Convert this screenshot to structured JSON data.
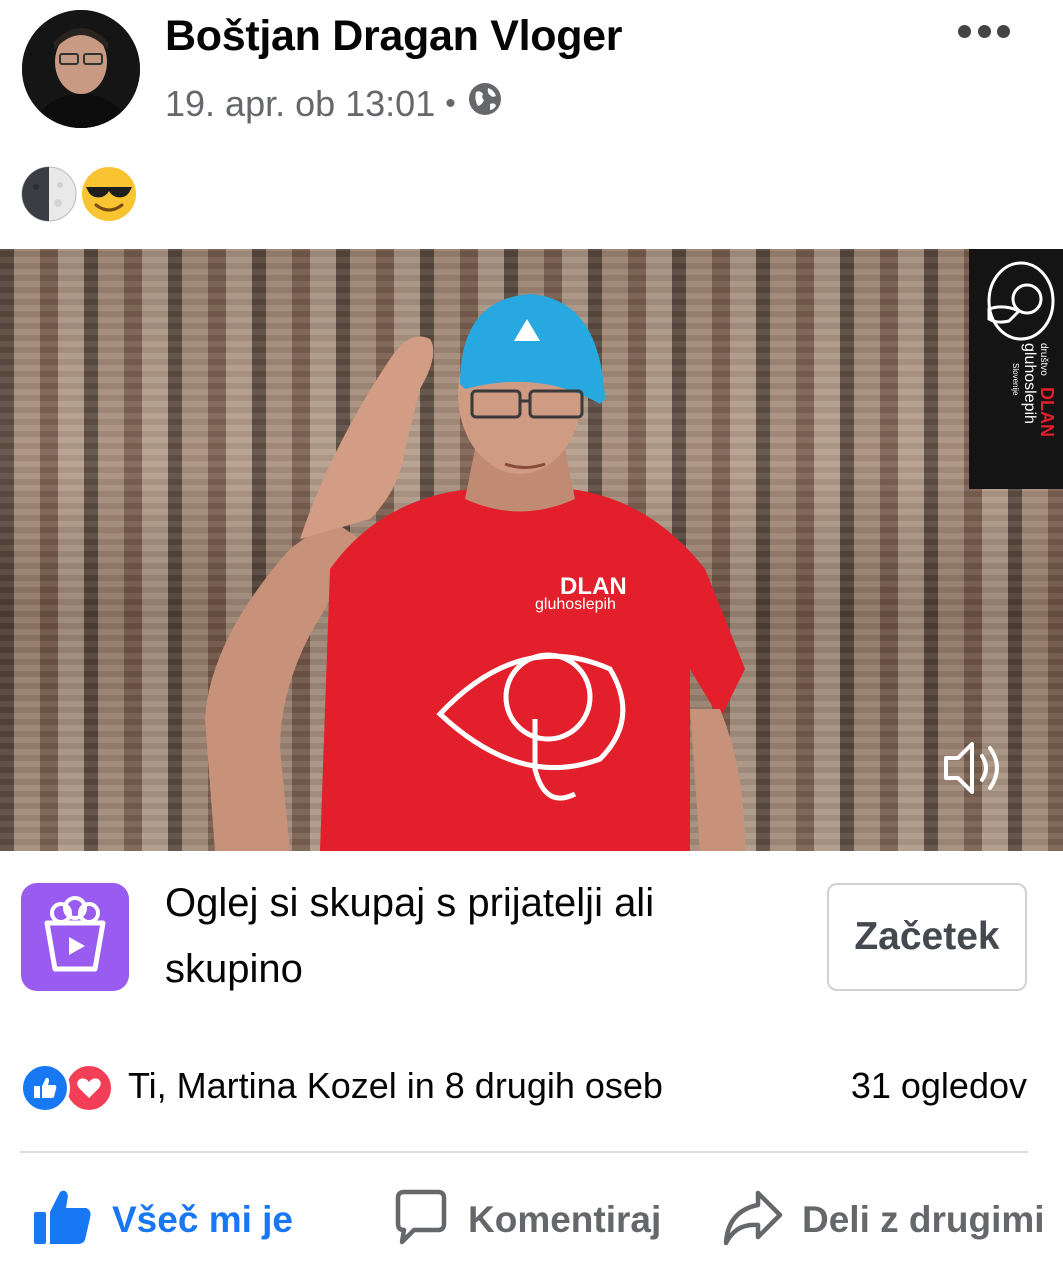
{
  "post": {
    "author": "Boštjan Dragan Vloger",
    "date": "19. apr. ob 13:01",
    "separator": "•",
    "privacy_icon": "globe-icon",
    "emojis": [
      "last-quarter-moon-icon",
      "smiling-face-with-sunglasses-icon"
    ]
  },
  "video": {
    "overlay_logo": {
      "line_small": "društvo",
      "brand": "DLAN",
      "subtitle": "gluhoslepih",
      "country": "Slovenije"
    },
    "sound_icon": "speaker-icon"
  },
  "watch_together": {
    "text": "Oglej si skupaj s prijatelji ali skupino",
    "button_label": "Začetek",
    "icon": "popcorn-play-icon"
  },
  "engagement": {
    "reactions_text": "Ti, Martina Kozel in 8 drugih oseb",
    "views": "31 ogledov",
    "reaction_icons": [
      "like-reaction-icon",
      "love-reaction-icon"
    ]
  },
  "actions": {
    "like_label": "Všeč mi je",
    "comment_label": "Komentiraj",
    "share_label": "Deli z drugimi"
  },
  "colors": {
    "facebook_blue": "#1877f2",
    "love_red": "#f33e58",
    "watch_purple": "#9a5cf0",
    "shirt_red": "#e8202a",
    "cap_blue": "#2aa7e0"
  }
}
